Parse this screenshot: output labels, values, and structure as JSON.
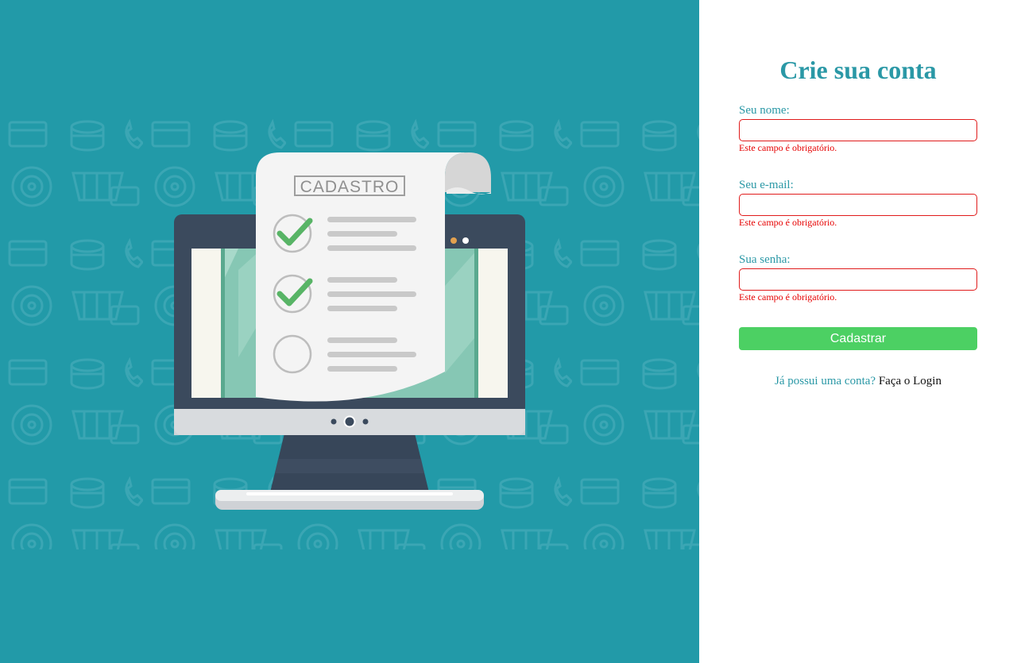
{
  "hero": {
    "card_heading": "CADASTRO",
    "checklist": [
      {
        "state": "checked"
      },
      {
        "state": "checked"
      },
      {
        "state": "unchecked"
      }
    ]
  },
  "form": {
    "title": "Crie sua conta",
    "fields": [
      {
        "label": "Seu nome:",
        "value": "",
        "error": "Este campo é obrigatório."
      },
      {
        "label": "Seu e-mail:",
        "value": "",
        "error": "Este campo é obrigatório."
      },
      {
        "label": "Sua senha:",
        "value": "",
        "error": "Este campo é obrigatório."
      }
    ],
    "submit_label": "Cadastrar",
    "login_prompt": "Já possui uma conta?",
    "login_link": "Faça o Login"
  },
  "colors": {
    "panel_background": "#229aa8",
    "accent": "#2a98a6",
    "error": "#e60000",
    "submit": "#4cd063"
  }
}
